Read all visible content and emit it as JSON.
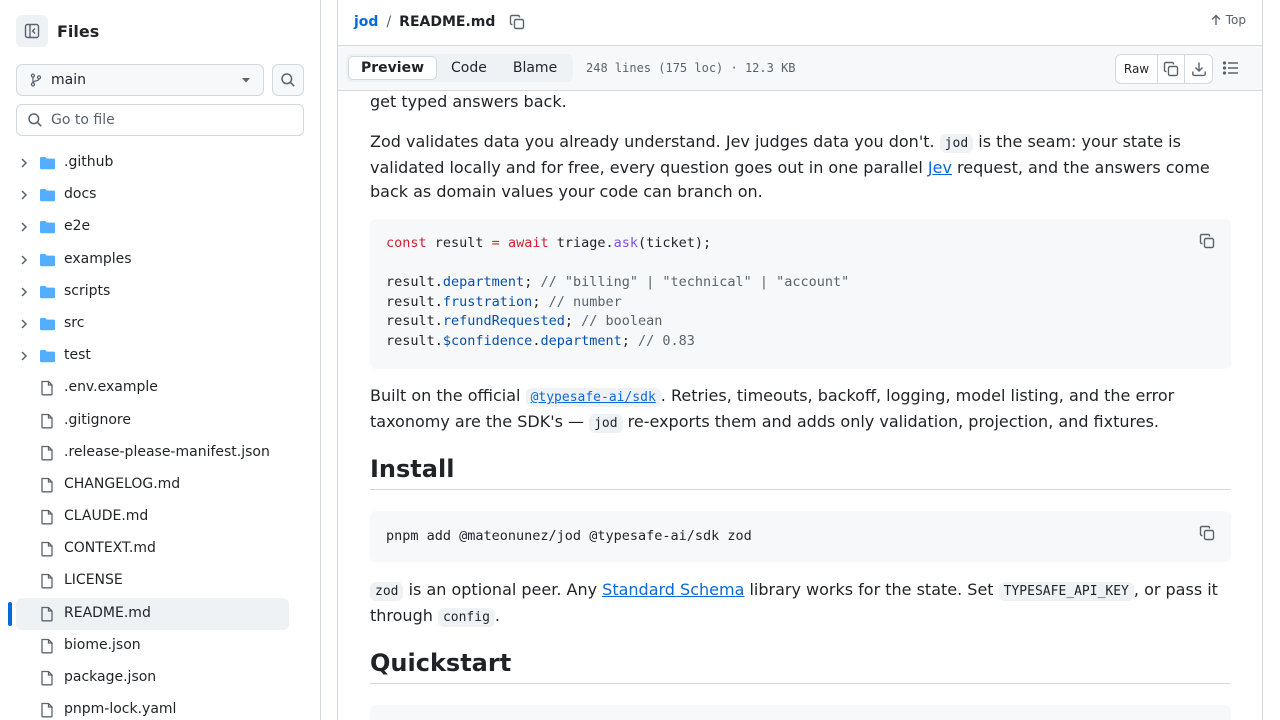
{
  "sidebar": {
    "title": "Files",
    "branch": "main",
    "goto_placeholder": "Go to file",
    "items": [
      {
        "label": ".github",
        "type": "folder"
      },
      {
        "label": "docs",
        "type": "folder"
      },
      {
        "label": "e2e",
        "type": "folder"
      },
      {
        "label": "examples",
        "type": "folder"
      },
      {
        "label": "scripts",
        "type": "folder"
      },
      {
        "label": "src",
        "type": "folder"
      },
      {
        "label": "test",
        "type": "folder"
      },
      {
        "label": ".env.example",
        "type": "file"
      },
      {
        "label": ".gitignore",
        "type": "file"
      },
      {
        "label": ".release-please-manifest.json",
        "type": "file"
      },
      {
        "label": "CHANGELOG.md",
        "type": "file"
      },
      {
        "label": "CLAUDE.md",
        "type": "file"
      },
      {
        "label": "CONTEXT.md",
        "type": "file"
      },
      {
        "label": "LICENSE",
        "type": "file"
      },
      {
        "label": "README.md",
        "type": "file",
        "active": true
      },
      {
        "label": "biome.json",
        "type": "file"
      },
      {
        "label": "package.json",
        "type": "file"
      },
      {
        "label": "pnpm-lock.yaml",
        "type": "file"
      }
    ]
  },
  "header": {
    "repo": "jod",
    "separator": "/",
    "file": "README.md",
    "top_label": "Top"
  },
  "toolbar": {
    "tabs": [
      "Preview",
      "Code",
      "Blame"
    ],
    "active_tab": "Preview",
    "file_info": "248 lines (175 loc) · 12.3 KB",
    "raw_label": "Raw"
  },
  "article": {
    "p0": "get typed answers back.",
    "p1": {
      "a": "Zod validates data you already understand. Jev judges data you don't. ",
      "code": "jod",
      "b": " is the seam: your state is validated locally and for free, every question goes out in one parallel ",
      "link": "Jev",
      "c": " request, and the answers come back as domain values your code can branch on."
    },
    "code1": {
      "l1": {
        "kw1": "const",
        "t1": " result ",
        "op": "=",
        "t2": " ",
        "kw2": "await",
        "t3": " triage.",
        "fn": "ask",
        "t4": "(ticket);"
      },
      "l2": {
        "t1": "result.",
        "prop": "department",
        "t2": "; ",
        "cm": "// \"billing\" | \"technical\" | \"account\""
      },
      "l3": {
        "t1": "result.",
        "prop": "frustration",
        "t2": "; ",
        "cm": "// number"
      },
      "l4": {
        "t1": "result.",
        "prop": "refundRequested",
        "t2": "; ",
        "cm": "// boolean"
      },
      "l5": {
        "t1": "result.",
        "prop": "$confidence",
        "t2": ".",
        "prop2": "department",
        "t3": "; ",
        "cm": "// 0.83"
      }
    },
    "p2": {
      "a": "Built on the official ",
      "code_link": "@typesafe-ai/sdk",
      "b": ". Retries, timeouts, backoff, logging, model listing, and the error taxonomy are the SDK's — ",
      "code": "jod",
      "c": " re-exports them and adds only validation, projection, and fixtures."
    },
    "h_install": "Install",
    "code2": "pnpm add @mateonunez/jod @typesafe-ai/sdk zod",
    "p3": {
      "code1": "zod",
      "a": " is an optional peer. Any ",
      "link": "Standard Schema",
      "b": " library works for the state. Set ",
      "code2": "TYPESAFE_API_KEY",
      "c": ", or pass it through ",
      "code3": "config",
      "d": "."
    },
    "h_quickstart": "Quickstart"
  },
  "icons": {
    "sidebar_toggle": "sidebar-collapse-icon",
    "branch": "git-branch-icon",
    "search": "search-icon",
    "folder": "folder-icon",
    "file": "file-icon",
    "copy": "copy-icon",
    "download": "download-icon",
    "outline": "list-unordered-icon",
    "arrow_up": "arrow-up-icon"
  },
  "colors": {
    "accent": "#0969da",
    "folder": "#54aeff",
    "border": "#d1d9e0",
    "muted": "#59636e"
  }
}
